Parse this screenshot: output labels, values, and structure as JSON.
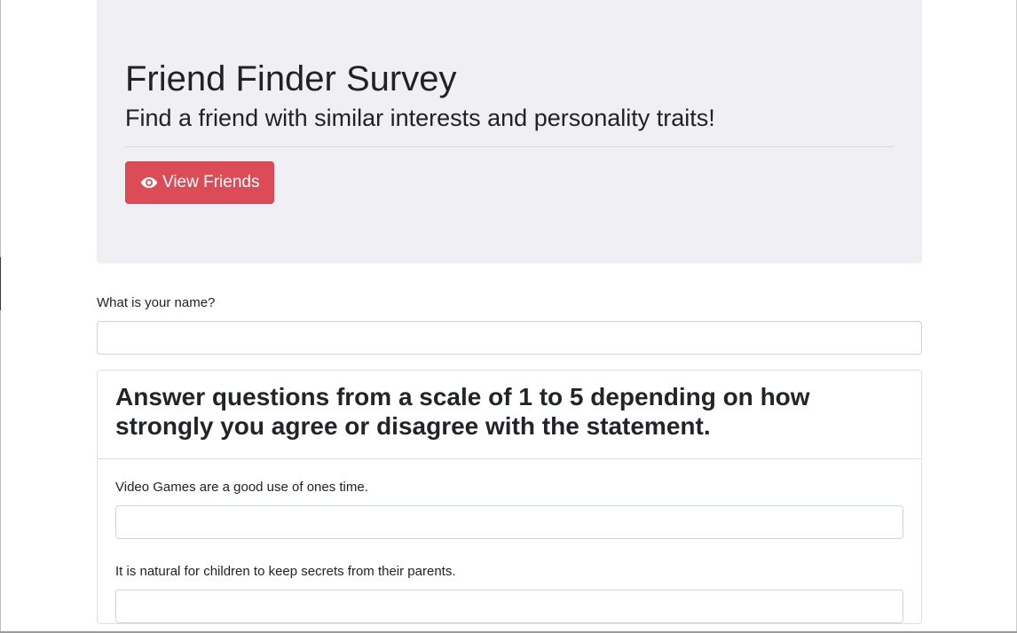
{
  "header": {
    "title": "Friend Finder Survey",
    "subtitle": "Find a friend with similar interests and personality traits!",
    "view_friends_button": {
      "label": "View Friends",
      "icon": "eye-icon",
      "color": "#dc4c56"
    }
  },
  "form": {
    "name_label": "What is your name?",
    "name_value": ""
  },
  "questions_card": {
    "heading": "Answer questions from a scale of 1 to 5 depending on how strongly you agree or disagree with the statement.",
    "questions": [
      {
        "label": "Video Games are a good use of ones time.",
        "value": ""
      },
      {
        "label": "It is natural for children to keep secrets from their parents.",
        "value": ""
      }
    ]
  }
}
